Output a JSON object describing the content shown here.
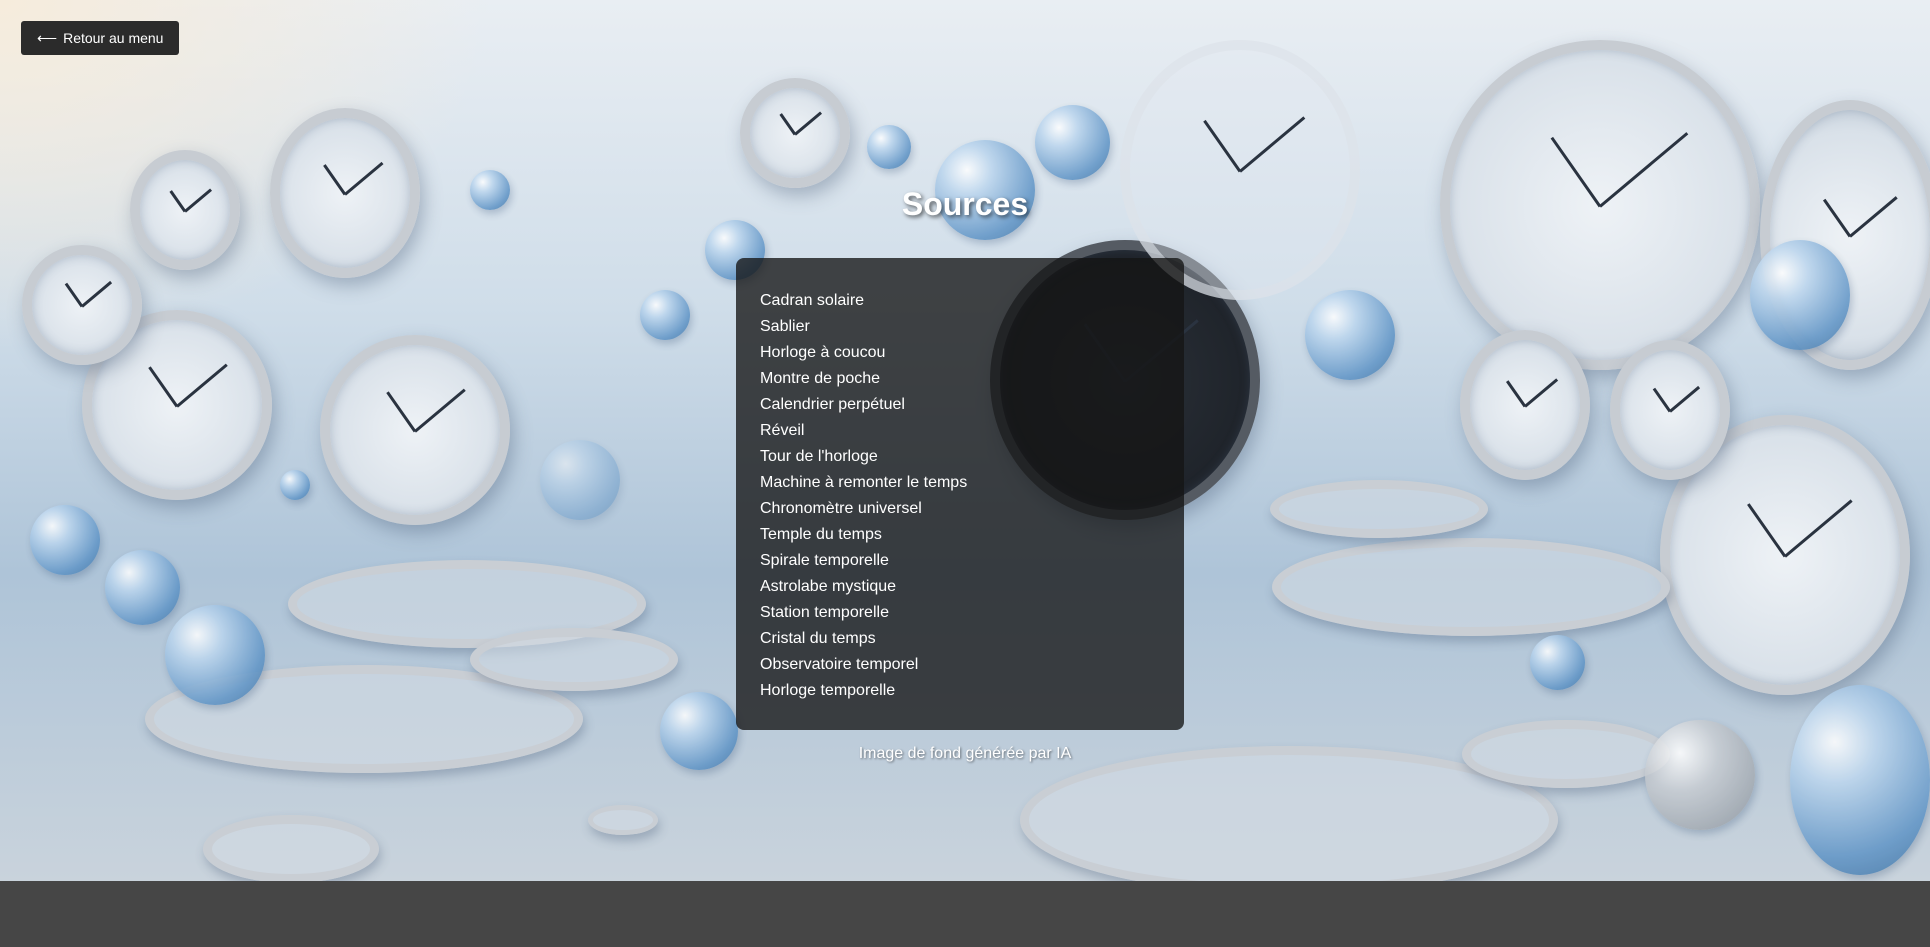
{
  "nav": {
    "back_arrow": "⟵",
    "back_label": "Retour au menu"
  },
  "page": {
    "title": "Sources",
    "credit": "Image de fond générée par IA"
  },
  "sources": [
    "Cadran solaire",
    "Sablier",
    "Horloge à coucou",
    "Montre de poche",
    "Calendrier perpétuel",
    "Réveil",
    "Tour de l'horloge",
    "Machine à remonter le temps",
    "Chronomètre universel",
    "Temple du temps",
    "Spirale temporelle",
    "Astrolabe mystique",
    "Station temporelle",
    "Cristal du temps",
    "Observatoire temporel",
    "Horloge temporelle"
  ],
  "colors": {
    "panel_bg": "#141414",
    "button_bg": "#2b2b2b",
    "footer_bg": "#464646",
    "text": "#ffffff"
  }
}
